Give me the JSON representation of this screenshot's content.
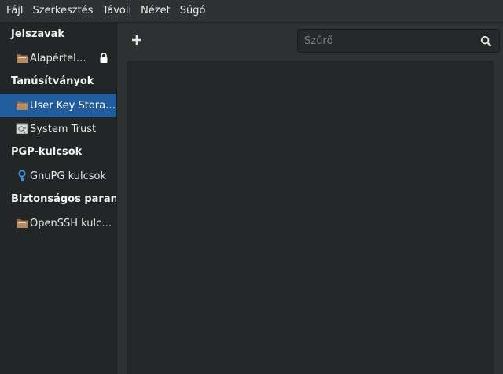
{
  "menubar": {
    "items": [
      "Fájl",
      "Szerkesztés",
      "Távoli",
      "Nézet",
      "Súgó"
    ]
  },
  "sidebar": {
    "sections": [
      {
        "title": "Jelszavak",
        "items": [
          {
            "label": "Alapértel…",
            "icon": "folder-icon",
            "locked": true
          }
        ]
      },
      {
        "title": "Tanúsítványok",
        "items": [
          {
            "label": "User Key Stora…",
            "icon": "folder-icon",
            "selected": true
          },
          {
            "label": "System Trust",
            "icon": "certificate-icon"
          }
        ]
      },
      {
        "title": "PGP-kulcsok",
        "items": [
          {
            "label": "GnuPG kulcsok",
            "icon": "key-icon"
          }
        ]
      },
      {
        "title": "Biztonságos parancs",
        "items": [
          {
            "label": "OpenSSH kulcsok",
            "icon": "folder-icon"
          }
        ]
      }
    ]
  },
  "toolbar": {
    "add_icon": "plus-icon",
    "filter_placeholder": "Szűrő",
    "filter_value": "",
    "search_icon": "search-icon"
  },
  "colors": {
    "selection": "#215d9c",
    "background": "#2f3233",
    "sidebar": "#232627"
  }
}
